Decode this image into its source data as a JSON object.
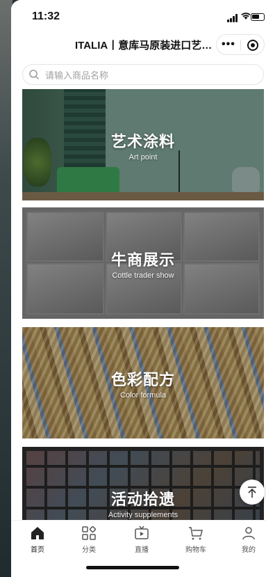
{
  "status_bar": {
    "time": "11:32"
  },
  "nav": {
    "title": "ITALIA丨意库马原装进口艺…",
    "more_label": "•••"
  },
  "search": {
    "placeholder": "请输入商品名称"
  },
  "cards": [
    {
      "cn": "艺术涂料",
      "en": "Art point"
    },
    {
      "cn": "牛商展示",
      "en": "Cottle trader show"
    },
    {
      "cn": "色彩配方",
      "en": "Color formula"
    },
    {
      "cn": "活动拾遗",
      "en": "Activity supplements"
    }
  ],
  "tabs": [
    {
      "label": "首页",
      "icon": "home-icon"
    },
    {
      "label": "分类",
      "icon": "category-icon"
    },
    {
      "label": "直播",
      "icon": "live-tv-icon"
    },
    {
      "label": "购物车",
      "icon": "cart-icon"
    },
    {
      "label": "我的",
      "icon": "user-icon"
    }
  ],
  "colors": {
    "accent": "#111111",
    "tab_text": "#555555"
  }
}
